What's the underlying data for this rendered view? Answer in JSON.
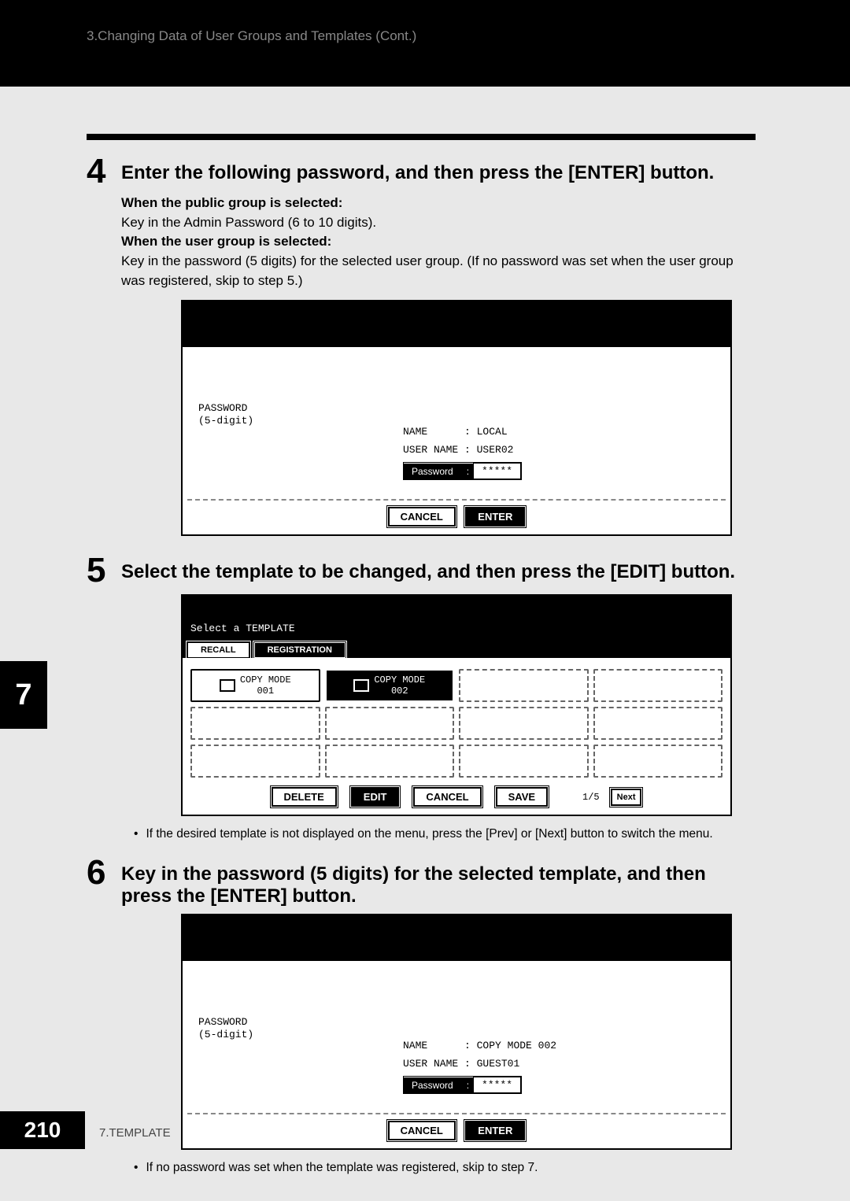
{
  "header": {
    "crumb": "3.Changing Data of User Groups and Templates (Cont.)"
  },
  "side_tab": "7",
  "footer": {
    "page": "210",
    "chapter": "7.TEMPLATE"
  },
  "step4": {
    "num": "4",
    "title": "Enter the following password, and then press the [ENTER] button.",
    "public_bold": "When the public group is selected:",
    "public_text": "Key in the Admin Password (6 to 10 digits).",
    "user_bold": "When the user group is selected:",
    "user_text": "Key in the password (5 digits) for the selected user group. (If no password was set when the user group was registered, skip to step 5.)",
    "panel": {
      "pwd_header": "PASSWORD\n(5-digit)",
      "name_label": "NAME",
      "name_value": ": LOCAL",
      "user_label": "USER NAME",
      "user_value": ": USER02",
      "pwd_box_label": "Password",
      "pwd_box_value": "*****",
      "cancel": "CANCEL",
      "enter": "ENTER"
    }
  },
  "step5": {
    "num": "5",
    "title": "Select the template to be changed, and then press the [EDIT] button.",
    "panel": {
      "select_text": "Select a TEMPLATE",
      "tab_recall": "RECALL",
      "tab_reg": "REGISTRATION",
      "cell1": "COPY MODE\n001",
      "cell2": "COPY MODE\n002",
      "btn_delete": "DELETE",
      "btn_edit": "EDIT",
      "btn_cancel": "CANCEL",
      "btn_save": "SAVE",
      "page_ind": "1/5",
      "btn_next": "Next"
    },
    "note": "If the desired template is not displayed on the menu, press the [Prev] or [Next] button to switch the menu."
  },
  "step6": {
    "num": "6",
    "title": "Key in the password (5 digits) for the selected template, and then press the [ENTER] button.",
    "panel": {
      "pwd_header": "PASSWORD\n(5-digit)",
      "name_label": "NAME",
      "name_value": ": COPY MODE 002",
      "user_label": "USER NAME",
      "user_value": ": GUEST01",
      "pwd_box_label": "Password",
      "pwd_box_value": "*****",
      "cancel": "CANCEL",
      "enter": "ENTER"
    },
    "note": "If no password was set when the template was registered, skip to step 7."
  }
}
